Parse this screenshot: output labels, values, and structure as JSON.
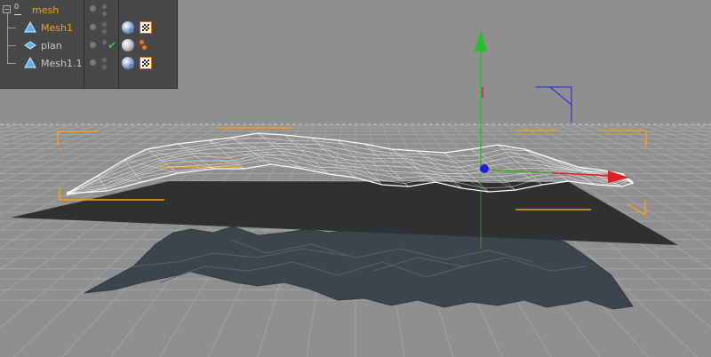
{
  "object_manager": {
    "objects": [
      {
        "name": "mesh",
        "active": true,
        "indent": 0,
        "type_icon": "null-object-icon",
        "expanded": true,
        "layer": "0"
      },
      {
        "name": "Mesh1",
        "active": true,
        "indent": 1,
        "type_icon": "polygon-object-icon"
      },
      {
        "name": "plan",
        "active": false,
        "indent": 1,
        "type_icon": "plane-object-icon",
        "checked": true
      },
      {
        "name": "Mesh1.1",
        "active": false,
        "indent": 1,
        "type_icon": "polygon-object-icon"
      }
    ],
    "expand_symbol": "−",
    "check_symbol": "✔"
  },
  "viewport": {
    "background": "#8f8f8f",
    "grid_color": "#a3a3a3",
    "horizon_color": "#c8c8c8",
    "bbox_color": "#f0a020",
    "axis_y_color": "#22c22c",
    "axis_x_color": "#e02020",
    "axis_z_color": "#2020e0",
    "wireframe_color": "#ffffff",
    "plane_color": "#2f3032",
    "mesh_color": "#3e444c"
  }
}
